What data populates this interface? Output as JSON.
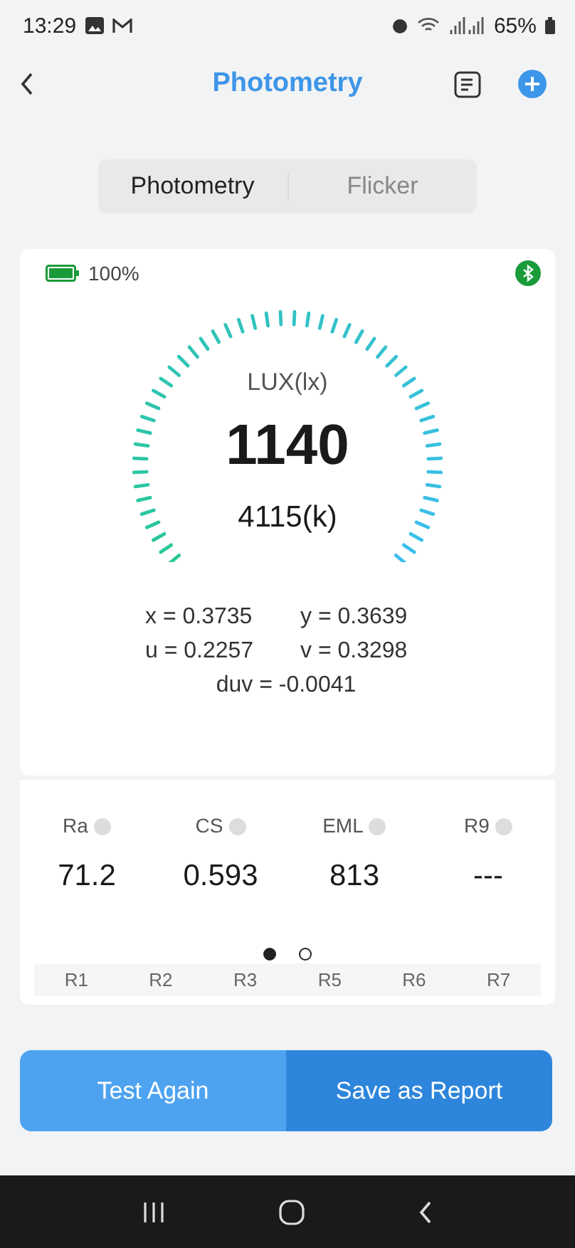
{
  "status_bar": {
    "time": "13:29",
    "battery": "65%"
  },
  "header": {
    "title": "Photometry"
  },
  "tabs": [
    {
      "label": "Photometry",
      "selected": true
    },
    {
      "label": "Flicker",
      "selected": false
    }
  ],
  "meter": {
    "battery": "100%",
    "bluetooth_connected": true,
    "gauge_label": "LUX(lx)",
    "lux": "1140",
    "cct": "4115(k)"
  },
  "coordinates": [
    {
      "label": "x = 0.3735"
    },
    {
      "label": "y = 0.3639"
    },
    {
      "label": "u = 0.2257"
    },
    {
      "label": "v = 0.3298"
    },
    {
      "label": "duv = -0.0041"
    }
  ],
  "metrics": [
    {
      "name": "Ra",
      "value": "71.2"
    },
    {
      "name": "CS",
      "value": "0.593"
    },
    {
      "name": "EML",
      "value": "813"
    },
    {
      "name": "R9",
      "value": "---"
    }
  ],
  "pager": [
    {
      "selected": true
    },
    {
      "selected": false
    }
  ],
  "r_values": [
    "R1",
    "R2",
    "R3",
    "R5",
    "R6",
    "R7"
  ],
  "buttons": [
    {
      "label": "Test Again",
      "kind": "secondary"
    },
    {
      "label": "Save as Report",
      "kind": "primary"
    }
  ]
}
